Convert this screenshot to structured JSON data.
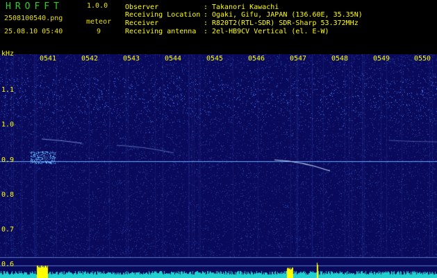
{
  "header": {
    "app_name": "HROFFT",
    "app_version": "1.0.0",
    "file_name": "2508100540.png",
    "date_time": "25.08.10 05:40",
    "count_label": "meteor",
    "count_value": "9"
  },
  "station_info": [
    {
      "label": "Observer",
      "value": "Takanori Kawachi"
    },
    {
      "label": "Receiving Location",
      "value": "Ogaki, Gifu, JAPAN (136.60E, 35.35N)"
    },
    {
      "label": "Receiver",
      "value": "R820T2(RTL-SDR) SDR-Sharp 53.372MHz"
    },
    {
      "label": "Receiving antenna",
      "value": "2el-HB9CV Vertical (el. E-W)"
    }
  ],
  "axes": {
    "y_unit": "kHz",
    "y_ticks": [
      "1.1",
      "1.0",
      "0.9",
      "0.8",
      "0.7",
      "0.6"
    ],
    "x_ticks": [
      "0541",
      "0542",
      "0543",
      "0544",
      "0545",
      "0546",
      "0547",
      "0548",
      "0549",
      "0550"
    ]
  },
  "colors": {
    "background": "#000000",
    "spectrogram_base": "#10106a",
    "noise_bright": "#4060ff",
    "signal": "#c0e0ff",
    "reference_line": "#6aa8ff",
    "axis_text": "#ffff00",
    "app_title": "#30d020",
    "bottom_trace": "#20d0d0",
    "bottom_peak": "#ffff00"
  }
}
